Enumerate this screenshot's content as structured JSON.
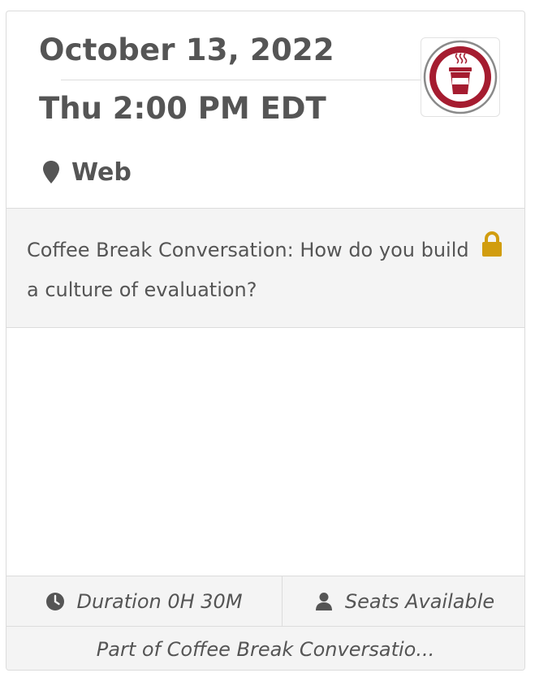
{
  "event": {
    "date": "October 13, 2022",
    "time": "Thu 2:00 PM EDT",
    "location": "Web",
    "title": "Coffee Break Conversation: How do you build a culture of evaluation?",
    "duration": "Duration 0H 30M",
    "seats": "Seats Available",
    "series": "Part of Coffee Break Conversatio..."
  },
  "icons": {
    "location": "map-marker-icon",
    "lock": "lock-icon",
    "duration": "clock-icon",
    "seats": "user-icon",
    "logo": "coffee-cup-logo"
  },
  "colors": {
    "text": "#555555",
    "lock": "#d19d0f",
    "logo_ring": "#a51c30",
    "band": "#f4f4f4",
    "border": "#dcdcdc"
  }
}
